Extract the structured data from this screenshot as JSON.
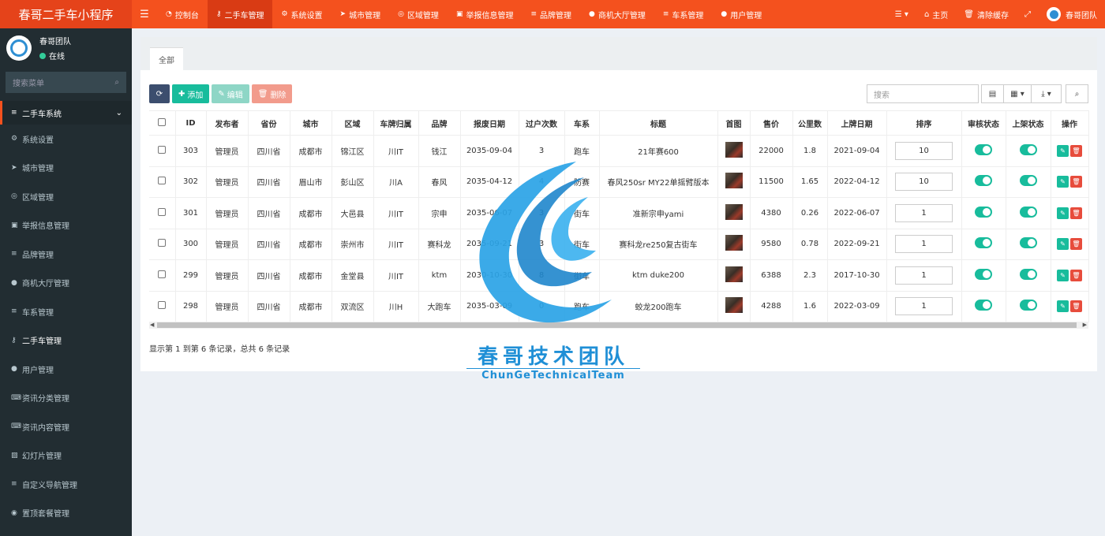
{
  "app": {
    "title": "春哥二手车小程序"
  },
  "topnav": [
    {
      "label": "控制台",
      "icon": "dashboard-icon"
    },
    {
      "label": "二手车管理",
      "icon": "sitemap-icon",
      "active": true
    },
    {
      "label": "系统设置",
      "icon": "gears-icon"
    },
    {
      "label": "城市管理",
      "icon": "location-arrow-icon"
    },
    {
      "label": "区域管理",
      "icon": "compass-icon"
    },
    {
      "label": "举报信息管理",
      "icon": "film-icon"
    },
    {
      "label": "品牌管理",
      "icon": "list-icon"
    },
    {
      "label": "商机大厅管理",
      "icon": "user-icon"
    },
    {
      "label": "车系管理",
      "icon": "list-icon"
    },
    {
      "label": "用户管理",
      "icon": "user-icon"
    }
  ],
  "topright": {
    "home": "主页",
    "clear_cache": "清除缓存",
    "user": "春哥团队"
  },
  "sidebar": {
    "user_name": "春哥团队",
    "status": "在线",
    "search_placeholder": "搜索菜单",
    "items": [
      {
        "label": "二手车系统",
        "icon": "list-icon"
      },
      {
        "label": "系统设置",
        "icon": "gears-icon"
      },
      {
        "label": "城市管理",
        "icon": "location-arrow-icon"
      },
      {
        "label": "区域管理",
        "icon": "compass-icon"
      },
      {
        "label": "举报信息管理",
        "icon": "film-icon"
      },
      {
        "label": "品牌管理",
        "icon": "list-icon"
      },
      {
        "label": "商机大厅管理",
        "icon": "user-icon"
      },
      {
        "label": "车系管理",
        "icon": "list-icon"
      },
      {
        "label": "二手车管理",
        "icon": "sitemap-icon"
      },
      {
        "label": "用户管理",
        "icon": "user-icon"
      },
      {
        "label": "资讯分类管理",
        "icon": "keyboard-icon"
      },
      {
        "label": "资讯内容管理",
        "icon": "keyboard-icon"
      },
      {
        "label": "幻灯片管理",
        "icon": "image-icon"
      },
      {
        "label": "自定义导航管理",
        "icon": "list-icon"
      },
      {
        "label": "置顶套餐管理",
        "icon": "circle-icon"
      }
    ]
  },
  "tabs": [
    {
      "label": "全部"
    }
  ],
  "toolbar": {
    "add": "添加",
    "edit": "编辑",
    "delete": "删除",
    "search_placeholder": "搜索"
  },
  "table": {
    "columns": [
      "ID",
      "发布者",
      "省份",
      "城市",
      "区域",
      "车牌归属",
      "品牌",
      "报废日期",
      "过户次数",
      "车系",
      "标题",
      "首图",
      "售价",
      "公里数",
      "上牌日期",
      "排序",
      "审核状态",
      "上架状态",
      "操作"
    ],
    "rows": [
      {
        "id": "303",
        "publisher": "管理员",
        "province": "四川省",
        "city": "成都市",
        "district": "锦江区",
        "plate": "川IT",
        "brand": "钱江",
        "scrap": "2035-09-04",
        "transfers": "3",
        "series": "跑车",
        "title": "21年赛600",
        "price": "22000",
        "km": "1.8",
        "reg": "2021-09-04",
        "sort": "10"
      },
      {
        "id": "302",
        "publisher": "管理员",
        "province": "四川省",
        "city": "眉山市",
        "district": "彭山区",
        "plate": "川A",
        "brand": "春风",
        "scrap": "2035-04-12",
        "transfers": "4",
        "series": "防赛",
        "title": "春风250sr MY22单摇臂版本",
        "price": "11500",
        "km": "1.65",
        "reg": "2022-04-12",
        "sort": "10"
      },
      {
        "id": "301",
        "publisher": "管理员",
        "province": "四川省",
        "city": "成都市",
        "district": "大邑县",
        "plate": "川IT",
        "brand": "宗申",
        "scrap": "2035-06-07",
        "transfers": "3",
        "series": "街车",
        "title": "准新宗申yami",
        "price": "4380",
        "km": "0.26",
        "reg": "2022-06-07",
        "sort": "1"
      },
      {
        "id": "300",
        "publisher": "管理员",
        "province": "四川省",
        "city": "成都市",
        "district": "崇州市",
        "plate": "川IT",
        "brand": "赛科龙",
        "scrap": "2035-09-21",
        "transfers": "3",
        "series": "街车",
        "title": "赛科龙re250复古街车",
        "price": "9580",
        "km": "0.78",
        "reg": "2022-09-21",
        "sort": "1"
      },
      {
        "id": "299",
        "publisher": "管理员",
        "province": "四川省",
        "city": "成都市",
        "district": "金堂县",
        "plate": "川IT",
        "brand": "ktm",
        "scrap": "2030-10-30",
        "transfers": "8",
        "series": "街车",
        "title": "ktm duke200",
        "price": "6388",
        "km": "2.3",
        "reg": "2017-10-30",
        "sort": "1"
      },
      {
        "id": "298",
        "publisher": "管理员",
        "province": "四川省",
        "city": "成都市",
        "district": "双流区",
        "plate": "川H",
        "brand": "大跑车",
        "scrap": "2035-03-09",
        "transfers": "0",
        "series": "跑车",
        "title": "蛟龙200跑车",
        "price": "4288",
        "km": "1.6",
        "reg": "2022-03-09",
        "sort": "1"
      }
    ]
  },
  "pagination": {
    "info": "显示第 1 到第 6 条记录，总共 6 条记录"
  },
  "watermark": {
    "title": "春哥技术团队",
    "subtitle": "ChunGeTechnicalTeam"
  },
  "colors": {
    "topbar": "#f4511e",
    "sidebar": "#222d32",
    "accent": "#18bc9c"
  }
}
